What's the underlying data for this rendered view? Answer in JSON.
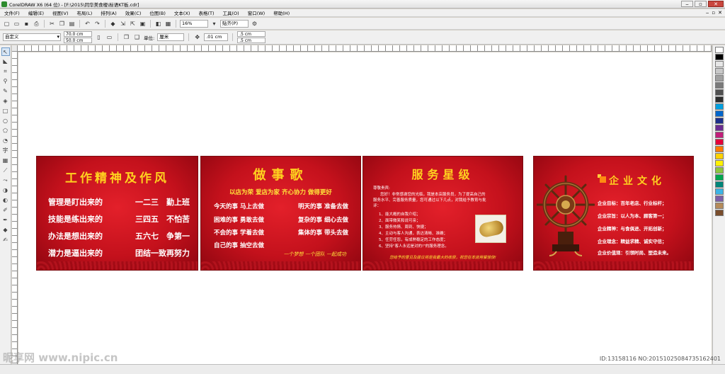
{
  "window": {
    "title": "CorelDRAW X6 (64 位) - [F:\\2015\\同华美食楼\\标语KT板.cdr]",
    "controls": [
      "‒",
      "▫",
      "✕"
    ]
  },
  "menu": {
    "items": [
      "文件(F)",
      "编辑(E)",
      "视图(V)",
      "布局(L)",
      "排列(A)",
      "效果(C)",
      "位图(B)",
      "文本(X)",
      "表格(T)",
      "工具(O)",
      "窗口(W)",
      "帮助(H)"
    ]
  },
  "toolbar": {
    "zoom": "16%",
    "snap": "贴齐(P)"
  },
  "propbar": {
    "page_preset": "自定义",
    "width": "70.0 cm",
    "height": "50.0 cm",
    "units_label": "单位:",
    "units": "厘米",
    "nudge": ".01 cm",
    "dup_x": ".5 cm",
    "dup_y": ".5 cm"
  },
  "boards": {
    "spirit": {
      "title": "工作精神及作风",
      "lines": [
        {
          "left": "管理是盯出来的",
          "right": "一二三　勤上班"
        },
        {
          "left": "技能是练出来的",
          "right": "三四五　不怕苦"
        },
        {
          "left": "办法是想出来的",
          "right": "五六七　争第一"
        },
        {
          "left": "潜力是逼出来的",
          "right": "一二三四五六七"
        }
      ],
      "last_line_suffix": "团结一致再努力"
    },
    "song": {
      "title": "做事歌",
      "subtitle": "以店为荣 爱店为家 齐心协力 做得更好",
      "rows": [
        {
          "left": "今天的事 马上去做",
          "right": "明天的事 准备去做"
        },
        {
          "left": "困难的事 勇敢去做",
          "right": "复杂的事 细心去做"
        },
        {
          "left": "不会的事 学着去做",
          "right": "集体的事 带头去做"
        },
        {
          "left": "自己的事 抽空去做",
          "right": ""
        }
      ],
      "slogan": "一个梦想 一个团队 一起成功"
    },
    "service": {
      "title": "服务星级",
      "greeting": "尊敬贵宾:",
      "intro": [
        "您好！非常感谢您的光临，我是本店服务员，为了提高自己的",
        "服务水平、完善服务质量，您可通过以下几点，对我给予教育与批",
        "评："
      ],
      "points": [
        "1、能大概的自我介绍；",
        "2、面带微笑和说可亲；",
        "3、服务热情、周到、快捷；",
        "4、主动与客人沟通，表达清晰、准确；",
        "5、任劳任怨，有成熟稳定的工作态度；",
        "6、坚持\"客人永远是对的!\"的服务理念。"
      ],
      "footer": "您给予的意见及建议将是我最大的收获，祝您在本店用餐愉快!"
    },
    "culture": {
      "title": "企业文化",
      "items": [
        "企业目标：百年老店、行业标杆；",
        "企业宗旨：以人为本、顾客第一；",
        "企业精神：与食俱进、开拓创新；",
        "企业理念：精益求精、诚实守信；",
        "企业价值观：引领时尚、塑造未来。"
      ]
    }
  },
  "palette_colors": [
    "#ffffff",
    "#000000",
    "#e6e6e6",
    "#c8c8c8",
    "#a0a0a0",
    "#7a7a7a",
    "#505050",
    "#2d2d2d",
    "#00a0e0",
    "#0066cc",
    "#1c2f8a",
    "#6a2c91",
    "#c21f7a",
    "#e4003a",
    "#ff7a00",
    "#ffd200",
    "#fff200",
    "#8cc63f",
    "#00a650",
    "#00877a",
    "#3cb4e5",
    "#7b5ea7",
    "#b58b5a",
    "#7a4e2d"
  ],
  "watermark": {
    "left": "昵享网 www.nipic.cn",
    "right": "ID:13158116 NO:20151025084735162401"
  }
}
